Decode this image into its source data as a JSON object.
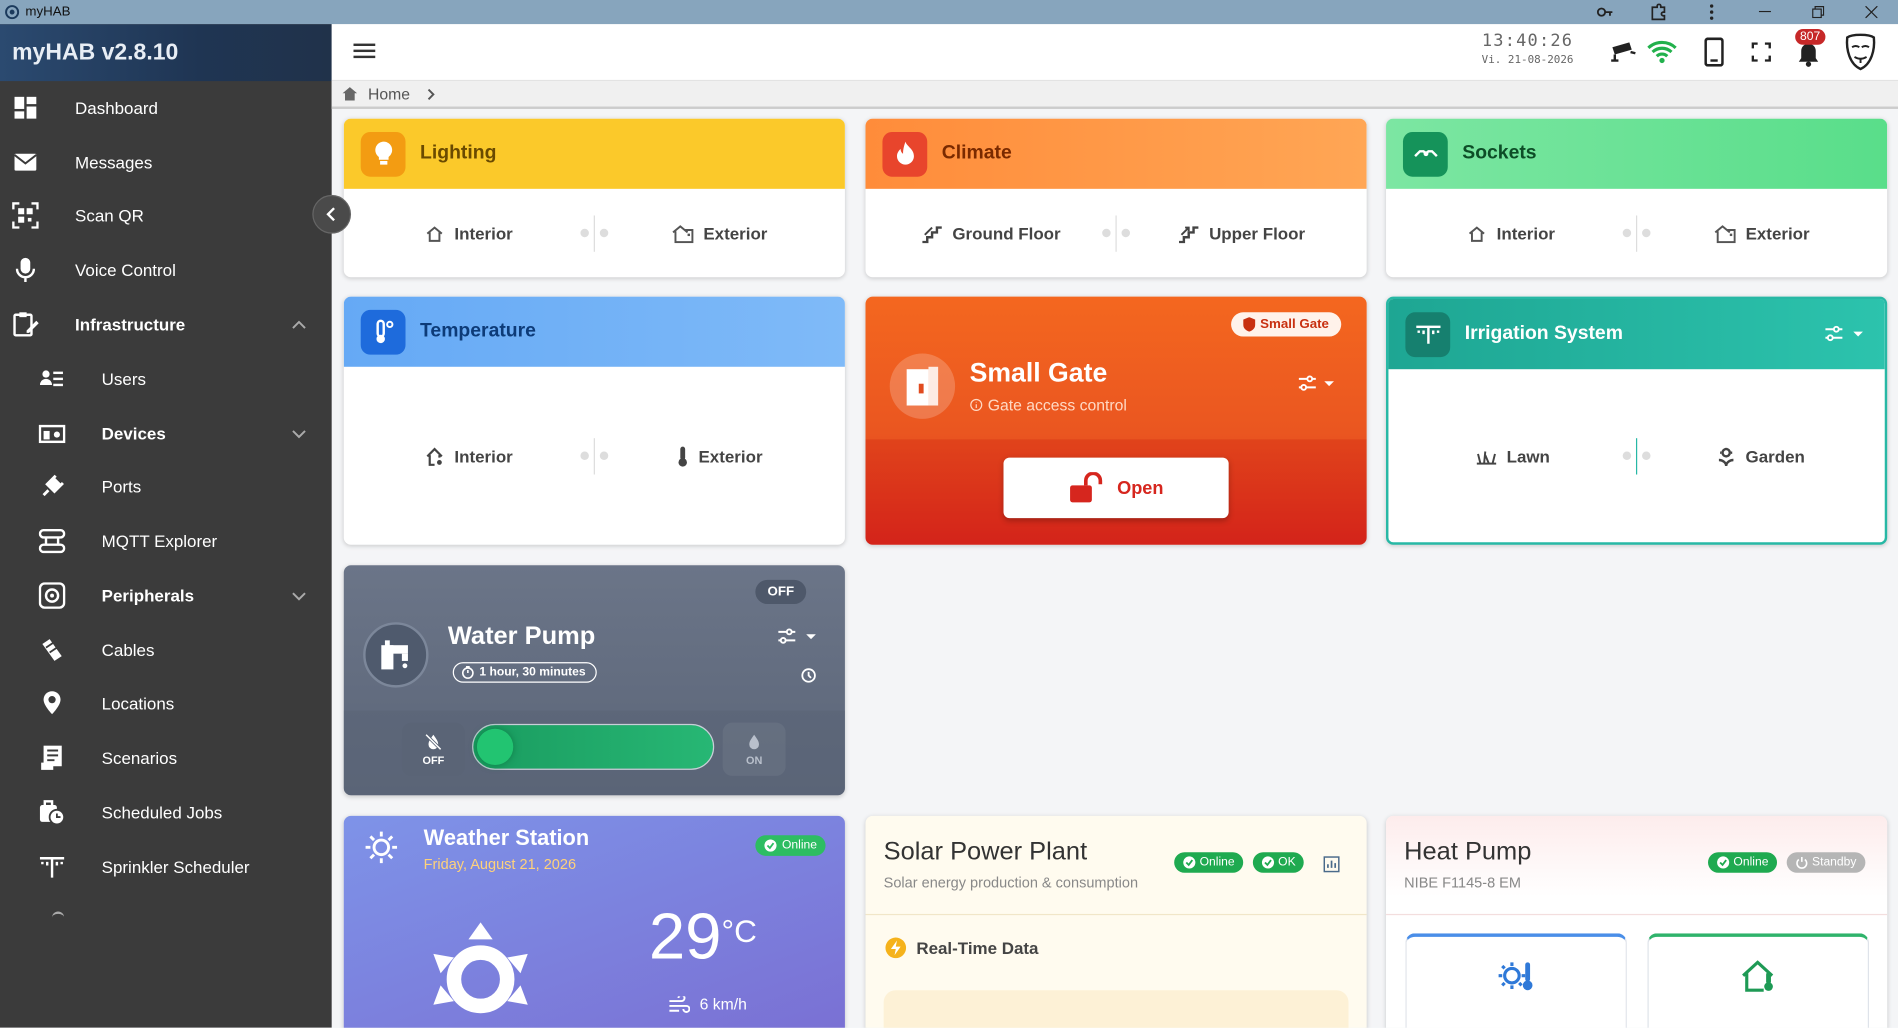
{
  "window": {
    "title": "myHAB"
  },
  "sidebar": {
    "brand": "myHAB v2.8.10",
    "items": [
      {
        "label": "Dashboard"
      },
      {
        "label": "Messages"
      },
      {
        "label": "Scan QR"
      },
      {
        "label": "Voice Control"
      },
      {
        "label": "Infrastructure"
      },
      {
        "label": "Users"
      },
      {
        "label": "Devices"
      },
      {
        "label": "Ports"
      },
      {
        "label": "MQTT Explorer"
      },
      {
        "label": "Peripherals"
      },
      {
        "label": "Cables"
      },
      {
        "label": "Locations"
      },
      {
        "label": "Scenarios"
      },
      {
        "label": "Scheduled Jobs"
      },
      {
        "label": "Sprinkler Scheduler"
      }
    ]
  },
  "topbar": {
    "time": "13:40:26",
    "date": "Vi. 21-08-2026",
    "notifications": "807"
  },
  "breadcrumb": {
    "home": "Home"
  },
  "lighting": {
    "title": "Lighting",
    "a": "Interior",
    "b": "Exterior",
    "color": "#f9c92c"
  },
  "climate": {
    "title": "Climate",
    "a": "Ground Floor",
    "b": "Upper Floor",
    "color": "#ff9a4a"
  },
  "sockets": {
    "title": "Sockets",
    "a": "Interior",
    "b": "Exterior",
    "color": "#5ee08c"
  },
  "temperature": {
    "title": "Temperature",
    "a": "Interior",
    "b": "Exterior",
    "color": "#6fb0f7"
  },
  "gate": {
    "badge": "Small Gate",
    "title": "Small Gate",
    "subtitle": "Gate access control",
    "button": "Open"
  },
  "irrigation": {
    "title": "Irrigation System",
    "a": "Lawn",
    "b": "Garden",
    "color": "#27b8a5"
  },
  "pump": {
    "status": "OFF",
    "title": "Water Pump",
    "duration": "1 hour, 30 minutes",
    "off_label": "OFF",
    "on_label": "ON"
  },
  "weather": {
    "title": "Weather Station",
    "date": "Friday, August 21, 2026",
    "status": "Online",
    "temp": "29",
    "unit": "°C",
    "wind": "6 km/h"
  },
  "solar": {
    "title": "Solar Power Plant",
    "subtitle": "Solar energy production & consumption",
    "status1": "Online",
    "status2": "OK",
    "section": "Real-Time Data"
  },
  "heatpump": {
    "title": "Heat Pump",
    "subtitle": "NIBE F1145-8 EM",
    "status1": "Online",
    "status2": "Standby"
  }
}
